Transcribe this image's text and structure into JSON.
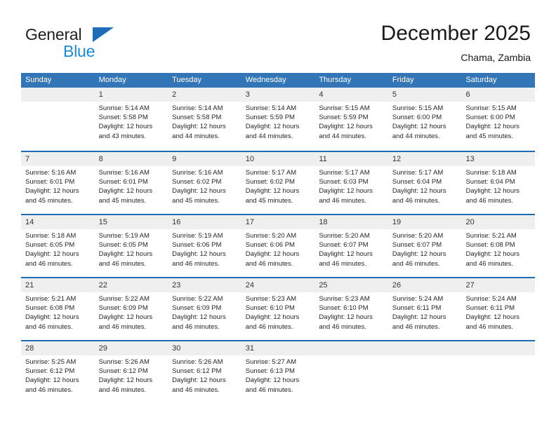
{
  "brand": {
    "word_general": "General",
    "word_blue": "Blue",
    "triangle_color": "#1f6db5",
    "blue_color": "#1b8ade"
  },
  "header": {
    "month_title": "December 2025",
    "location": "Chama, Zambia",
    "header_bg": "#3376b8",
    "row_rule_color": "#1f6cb0",
    "day_band_bg": "#efefef"
  },
  "weekdays": [
    "Sunday",
    "Monday",
    "Tuesday",
    "Wednesday",
    "Thursday",
    "Friday",
    "Saturday"
  ],
  "weeks": [
    [
      {
        "day": "",
        "lines": []
      },
      {
        "day": "1",
        "lines": [
          "Sunrise: 5:14 AM",
          "Sunset: 5:58 PM",
          "Daylight: 12 hours",
          "and 43 minutes."
        ]
      },
      {
        "day": "2",
        "lines": [
          "Sunrise: 5:14 AM",
          "Sunset: 5:58 PM",
          "Daylight: 12 hours",
          "and 44 minutes."
        ]
      },
      {
        "day": "3",
        "lines": [
          "Sunrise: 5:14 AM",
          "Sunset: 5:59 PM",
          "Daylight: 12 hours",
          "and 44 minutes."
        ]
      },
      {
        "day": "4",
        "lines": [
          "Sunrise: 5:15 AM",
          "Sunset: 5:59 PM",
          "Daylight: 12 hours",
          "and 44 minutes."
        ]
      },
      {
        "day": "5",
        "lines": [
          "Sunrise: 5:15 AM",
          "Sunset: 6:00 PM",
          "Daylight: 12 hours",
          "and 44 minutes."
        ]
      },
      {
        "day": "6",
        "lines": [
          "Sunrise: 5:15 AM",
          "Sunset: 6:00 PM",
          "Daylight: 12 hours",
          "and 45 minutes."
        ]
      }
    ],
    [
      {
        "day": "7",
        "lines": [
          "Sunrise: 5:16 AM",
          "Sunset: 6:01 PM",
          "Daylight: 12 hours",
          "and 45 minutes."
        ]
      },
      {
        "day": "8",
        "lines": [
          "Sunrise: 5:16 AM",
          "Sunset: 6:01 PM",
          "Daylight: 12 hours",
          "and 45 minutes."
        ]
      },
      {
        "day": "9",
        "lines": [
          "Sunrise: 5:16 AM",
          "Sunset: 6:02 PM",
          "Daylight: 12 hours",
          "and 45 minutes."
        ]
      },
      {
        "day": "10",
        "lines": [
          "Sunrise: 5:17 AM",
          "Sunset: 6:02 PM",
          "Daylight: 12 hours",
          "and 45 minutes."
        ]
      },
      {
        "day": "11",
        "lines": [
          "Sunrise: 5:17 AM",
          "Sunset: 6:03 PM",
          "Daylight: 12 hours",
          "and 46 minutes."
        ]
      },
      {
        "day": "12",
        "lines": [
          "Sunrise: 5:17 AM",
          "Sunset: 6:04 PM",
          "Daylight: 12 hours",
          "and 46 minutes."
        ]
      },
      {
        "day": "13",
        "lines": [
          "Sunrise: 5:18 AM",
          "Sunset: 6:04 PM",
          "Daylight: 12 hours",
          "and 46 minutes."
        ]
      }
    ],
    [
      {
        "day": "14",
        "lines": [
          "Sunrise: 5:18 AM",
          "Sunset: 6:05 PM",
          "Daylight: 12 hours",
          "and 46 minutes."
        ]
      },
      {
        "day": "15",
        "lines": [
          "Sunrise: 5:19 AM",
          "Sunset: 6:05 PM",
          "Daylight: 12 hours",
          "and 46 minutes."
        ]
      },
      {
        "day": "16",
        "lines": [
          "Sunrise: 5:19 AM",
          "Sunset: 6:06 PM",
          "Daylight: 12 hours",
          "and 46 minutes."
        ]
      },
      {
        "day": "17",
        "lines": [
          "Sunrise: 5:20 AM",
          "Sunset: 6:06 PM",
          "Daylight: 12 hours",
          "and 46 minutes."
        ]
      },
      {
        "day": "18",
        "lines": [
          "Sunrise: 5:20 AM",
          "Sunset: 6:07 PM",
          "Daylight: 12 hours",
          "and 46 minutes."
        ]
      },
      {
        "day": "19",
        "lines": [
          "Sunrise: 5:20 AM",
          "Sunset: 6:07 PM",
          "Daylight: 12 hours",
          "and 46 minutes."
        ]
      },
      {
        "day": "20",
        "lines": [
          "Sunrise: 5:21 AM",
          "Sunset: 6:08 PM",
          "Daylight: 12 hours",
          "and 46 minutes."
        ]
      }
    ],
    [
      {
        "day": "21",
        "lines": [
          "Sunrise: 5:21 AM",
          "Sunset: 6:08 PM",
          "Daylight: 12 hours",
          "and 46 minutes."
        ]
      },
      {
        "day": "22",
        "lines": [
          "Sunrise: 5:22 AM",
          "Sunset: 6:09 PM",
          "Daylight: 12 hours",
          "and 46 minutes."
        ]
      },
      {
        "day": "23",
        "lines": [
          "Sunrise: 5:22 AM",
          "Sunset: 6:09 PM",
          "Daylight: 12 hours",
          "and 46 minutes."
        ]
      },
      {
        "day": "24",
        "lines": [
          "Sunrise: 5:23 AM",
          "Sunset: 6:10 PM",
          "Daylight: 12 hours",
          "and 46 minutes."
        ]
      },
      {
        "day": "25",
        "lines": [
          "Sunrise: 5:23 AM",
          "Sunset: 6:10 PM",
          "Daylight: 12 hours",
          "and 46 minutes."
        ]
      },
      {
        "day": "26",
        "lines": [
          "Sunrise: 5:24 AM",
          "Sunset: 6:11 PM",
          "Daylight: 12 hours",
          "and 46 minutes."
        ]
      },
      {
        "day": "27",
        "lines": [
          "Sunrise: 5:24 AM",
          "Sunset: 6:11 PM",
          "Daylight: 12 hours",
          "and 46 minutes."
        ]
      }
    ],
    [
      {
        "day": "28",
        "lines": [
          "Sunrise: 5:25 AM",
          "Sunset: 6:12 PM",
          "Daylight: 12 hours",
          "and 46 minutes."
        ]
      },
      {
        "day": "29",
        "lines": [
          "Sunrise: 5:26 AM",
          "Sunset: 6:12 PM",
          "Daylight: 12 hours",
          "and 46 minutes."
        ]
      },
      {
        "day": "30",
        "lines": [
          "Sunrise: 5:26 AM",
          "Sunset: 6:12 PM",
          "Daylight: 12 hours",
          "and 46 minutes."
        ]
      },
      {
        "day": "31",
        "lines": [
          "Sunrise: 5:27 AM",
          "Sunset: 6:13 PM",
          "Daylight: 12 hours",
          "and 46 minutes."
        ]
      },
      {
        "day": "",
        "lines": []
      },
      {
        "day": "",
        "lines": []
      },
      {
        "day": "",
        "lines": []
      }
    ]
  ]
}
